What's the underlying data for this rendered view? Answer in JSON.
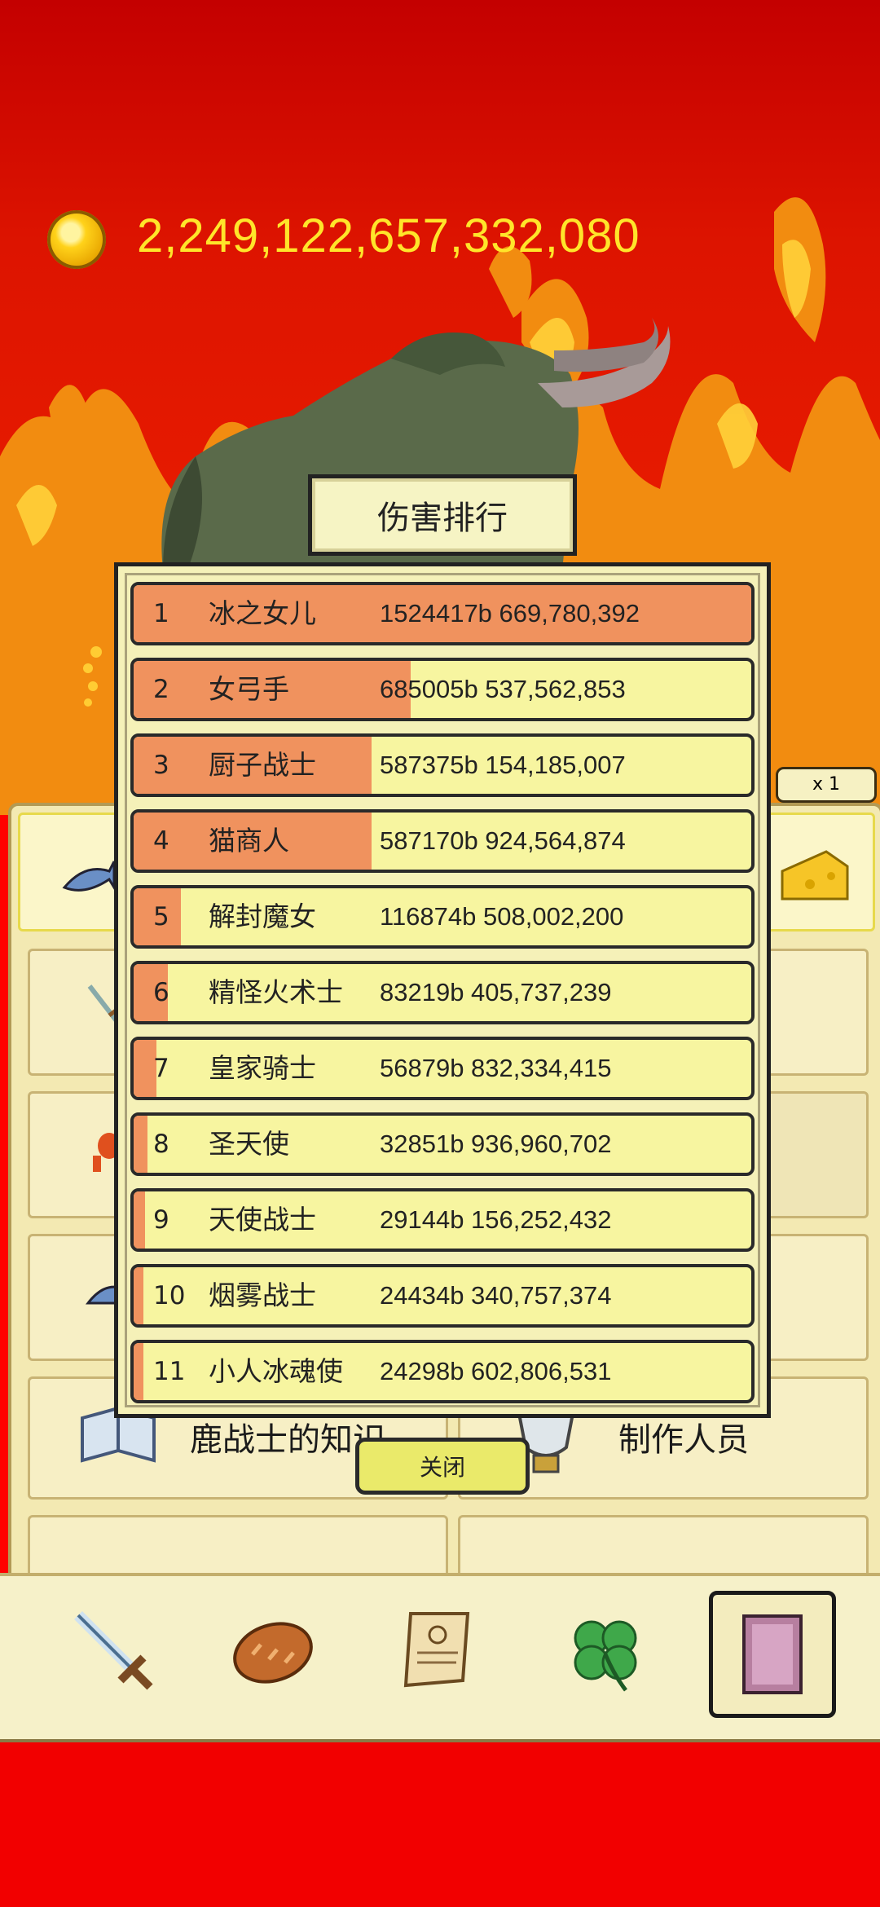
{
  "balance": "2,249,122,657,332,080",
  "speed_badge": "x 1",
  "dialog": {
    "title": "伤害排行",
    "close_label": "关闭",
    "rows": [
      {
        "rank": "1",
        "name": "冰之女儿",
        "value": "1524417b 669,780,392",
        "share": 1.0
      },
      {
        "rank": "2",
        "name": "女弓手",
        "value": "685005b 537,562,853",
        "share": 0.449
      },
      {
        "rank": "3",
        "name": "厨子战士",
        "value": "587375b 154,185,007",
        "share": 0.385
      },
      {
        "rank": "4",
        "name": "猫商人",
        "value": "587170b 924,564,874",
        "share": 0.385
      },
      {
        "rank": "5",
        "name": "解封魔女",
        "value": "116874b 508,002,200",
        "share": 0.077
      },
      {
        "rank": "6",
        "name": "精怪火术士",
        "value": "83219b 405,737,239",
        "share": 0.055
      },
      {
        "rank": "7",
        "name": "皇家骑士",
        "value": "56879b 832,334,415",
        "share": 0.037
      },
      {
        "rank": "8",
        "name": "圣天使",
        "value": "32851b 936,960,702",
        "share": 0.022
      },
      {
        "rank": "9",
        "name": "天使战士",
        "value": "29144b 156,252,432",
        "share": 0.019
      },
      {
        "rank": "10",
        "name": "烟雾战士",
        "value": "24434b 340,757,374",
        "share": 0.016
      },
      {
        "rank": "11",
        "name": "小人冰魂使",
        "value": "24298b 602,806,531",
        "share": 0.016
      }
    ]
  },
  "menu": {
    "knowledge_label": "鹿战士的知识",
    "credits_label": "制作人员"
  },
  "tabs": [
    "sword-icon",
    "bread-icon",
    "scroll-icon",
    "clover-icon",
    "book-icon"
  ],
  "colors": {
    "background_red": "#e61a00",
    "bar_orange": "#f0925e",
    "row_fill": "#f7f5a0",
    "coin_text": "#ffe52a"
  }
}
